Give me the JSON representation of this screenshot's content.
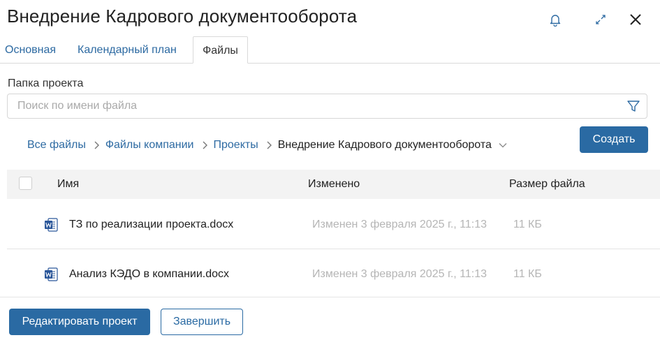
{
  "header": {
    "title": "Внедрение Кадрового документооборота"
  },
  "tabs": [
    {
      "label": "Основная",
      "active": false
    },
    {
      "label": "Календарный план",
      "active": false
    },
    {
      "label": "Файлы",
      "active": true
    }
  ],
  "folder": {
    "label": "Папка проекта",
    "search_placeholder": "Поиск по имени файла",
    "search_value": ""
  },
  "breadcrumb": {
    "items": [
      "Все файлы",
      "Файлы компании",
      "Проекты"
    ],
    "current": "Внедрение Кадрового документооборота"
  },
  "create_button": "Создать",
  "table": {
    "columns": [
      "Имя",
      "Изменено",
      "Размер файла"
    ],
    "rows": [
      {
        "name": "ТЗ по реализации проекта.docx",
        "modified": "Изменен 3 февраля 2025 г., 11:13",
        "size": "11 КБ"
      },
      {
        "name": "Анализ КЭДО в компании.docx",
        "modified": "Изменен 3 февраля 2025 г., 11:13",
        "size": "11 КБ"
      }
    ]
  },
  "footer": {
    "edit_button": "Редактировать проект",
    "finish_button": "Завершить"
  },
  "colors": {
    "accent": "#2a6aa3",
    "link": "#2d6aa2",
    "muted": "#b5b5b5",
    "word_icon": "#2b579a"
  },
  "icons": {
    "notifications": "bell-icon",
    "expand": "expand-icon",
    "close": "close-icon",
    "filter": "filter-icon",
    "file_type": "word-doc-icon"
  }
}
